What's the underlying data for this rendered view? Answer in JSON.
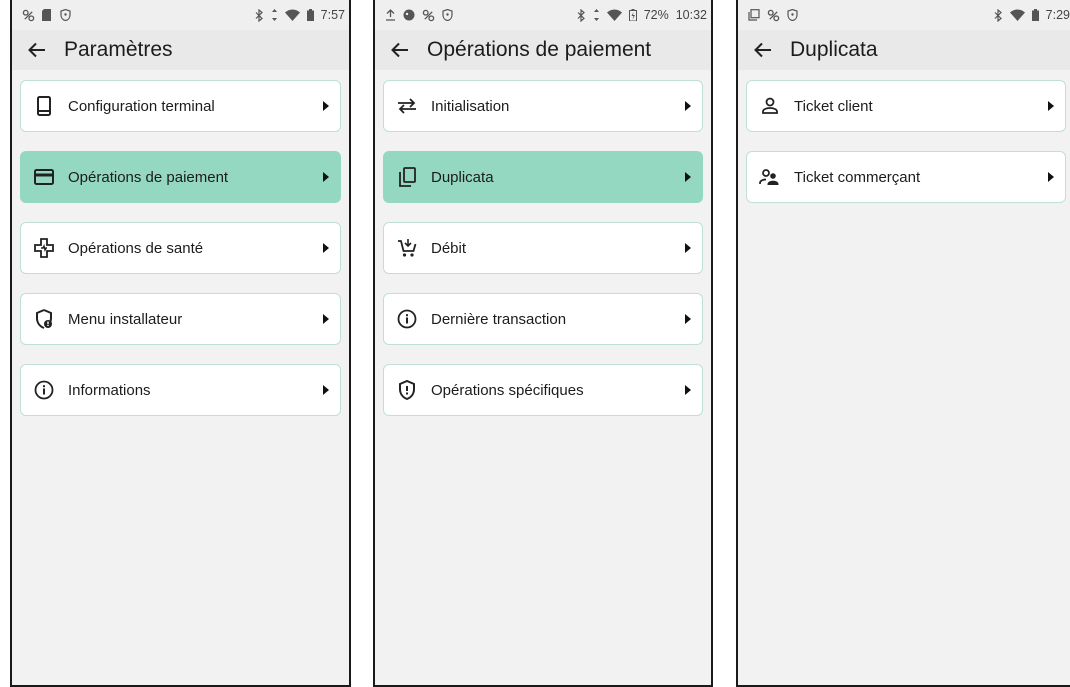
{
  "colors": {
    "accent": "#95d8c1",
    "card_border": "#bfe0d2",
    "background": "#f2f2f2",
    "appbar": "#e9e9e9"
  },
  "screens": [
    {
      "status": {
        "time": "7:57"
      },
      "title": "Paramètres",
      "items": [
        {
          "label": "Configuration terminal",
          "icon": "smartphone-icon",
          "active": false
        },
        {
          "label": "Opérations de paiement",
          "icon": "credit-card-icon",
          "active": true
        },
        {
          "label": "Opérations de santé",
          "icon": "health-cross-icon",
          "active": false
        },
        {
          "label": "Menu installateur",
          "icon": "installer-icon",
          "active": false
        },
        {
          "label": "Informations",
          "icon": "info-icon",
          "active": false
        }
      ]
    },
    {
      "status": {
        "battery": "72%",
        "time": "10:32"
      },
      "title": "Opérations de paiement",
      "items": [
        {
          "label": "Initialisation",
          "icon": "swap-arrows-icon",
          "active": false
        },
        {
          "label": "Duplicata",
          "icon": "copy-icon",
          "active": true
        },
        {
          "label": "Débit",
          "icon": "cart-icon",
          "active": false
        },
        {
          "label": "Dernière transaction",
          "icon": "info-icon",
          "active": false
        },
        {
          "label": "Opérations spécifiques",
          "icon": "shield-alert-icon",
          "active": false
        }
      ]
    },
    {
      "status": {
        "time": "7:29"
      },
      "title": "Duplicata",
      "items": [
        {
          "label": "Ticket client",
          "icon": "person-icon",
          "active": false
        },
        {
          "label": "Ticket commerçant",
          "icon": "people-icon",
          "active": false
        }
      ]
    }
  ]
}
